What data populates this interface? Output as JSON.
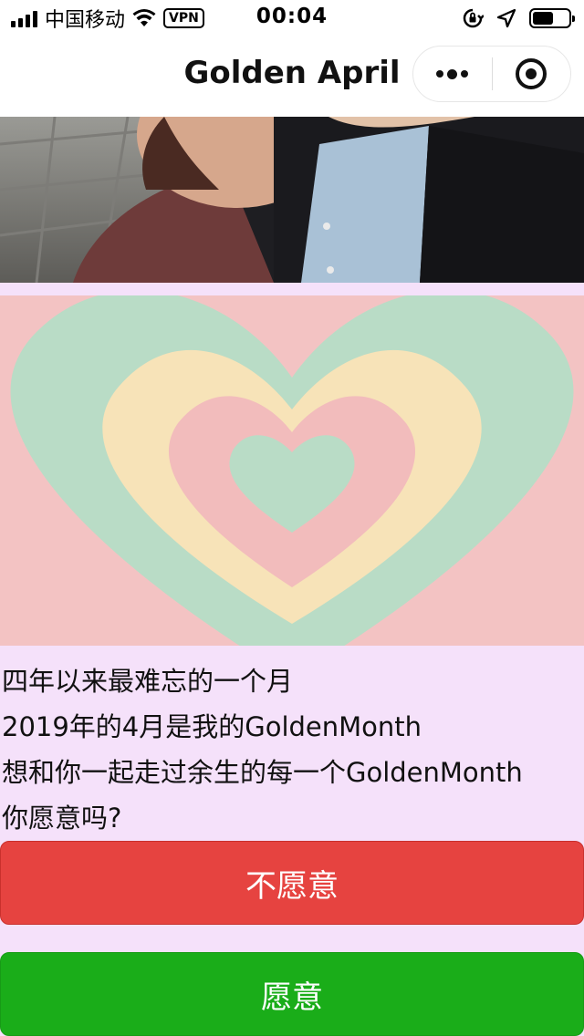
{
  "status_bar": {
    "carrier": "中国移动",
    "vpn_label": "VPN",
    "time": "00:04"
  },
  "nav": {
    "title": "Golden April",
    "more_icon": "more-dots-icon",
    "close_icon": "target-circle-icon"
  },
  "photo": {
    "icon": "couple-photo"
  },
  "heart": {
    "icon": "layered-heart-illustration",
    "colors": {
      "background": "#f3c3c3",
      "mint": "#b9dcc6",
      "cream": "#f7e3b8",
      "pink": "#f2bcbc"
    }
  },
  "message": {
    "lines": [
      "四年以来最难忘的一个月",
      "2019年的4月是我的GoldenMonth",
      "想和你一起走过余生的每一个GoldenMonth",
      "你愿意吗?"
    ]
  },
  "buttons": {
    "refuse_label": "不愿意",
    "accept_label": "愿意",
    "refuse_color": "#e64340",
    "accept_color": "#1aad19"
  },
  "page_background": "#f5e1fa"
}
